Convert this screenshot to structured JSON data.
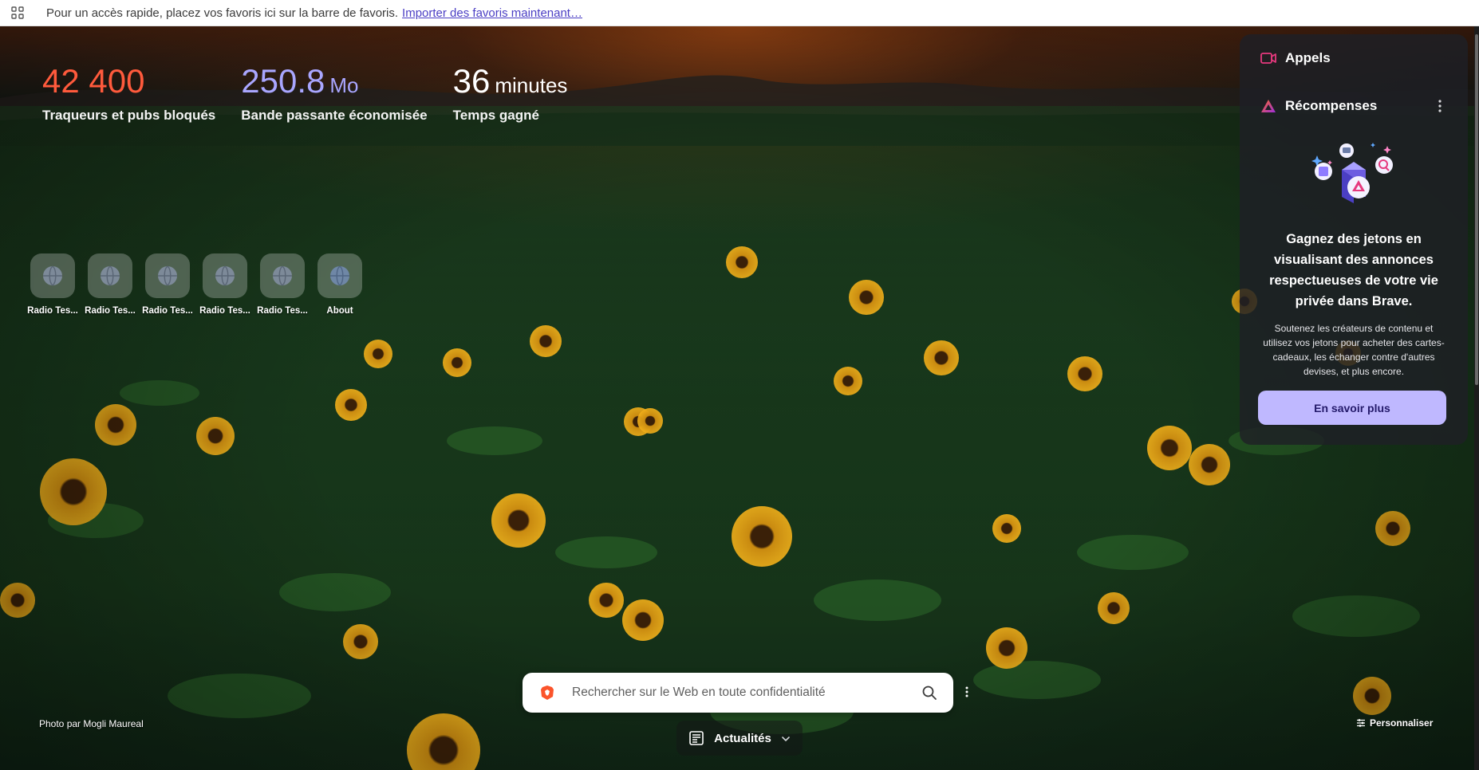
{
  "bookmarks_bar": {
    "message": "Pour un accès rapide, placez vos favoris ici sur la barre de favoris.",
    "import_link": "Importer des favoris maintenant…",
    "apps_icon": "apps-grid-icon"
  },
  "stats": {
    "trackers": {
      "value": "42 400",
      "label": "Traqueurs et pubs bloqués",
      "color": "#ff5a3c"
    },
    "bandwidth": {
      "value": "250.8",
      "unit": "Mo",
      "label": "Bande passante économisée",
      "color": "#a9a6ff"
    },
    "time": {
      "value": "36",
      "unit": "minutes",
      "label": "Temps gagné",
      "color": "#ffffff"
    }
  },
  "top_sites": [
    {
      "label": "Radio Tes...",
      "icon": "globe-icon"
    },
    {
      "label": "Radio Tes...",
      "icon": "globe-icon"
    },
    {
      "label": "Radio Tes...",
      "icon": "globe-icon"
    },
    {
      "label": "Radio Tes...",
      "icon": "globe-icon"
    },
    {
      "label": "Radio Tes...",
      "icon": "globe-icon"
    },
    {
      "label": "About",
      "icon": "globe-icon"
    }
  ],
  "widgets": {
    "calls": {
      "title": "Appels",
      "icon": "video-call-icon",
      "color": "#e6397e"
    },
    "rewards": {
      "title": "Récompenses",
      "icon": "brave-rewards-icon",
      "heading": "Gagnez des jetons en visualisant des annonces respectueuses de votre vie privée dans Brave.",
      "body": "Soutenez les créateurs de contenu et utilisez vos jetons pour acheter des cartes-cadeaux, les échanger contre d'autres devises, et plus encore.",
      "button": "En savoir plus",
      "button_color": "#bfb8ff"
    }
  },
  "search": {
    "placeholder": "Rechercher sur le Web en toute confidentialité",
    "value": ""
  },
  "news": {
    "label": "Actualités"
  },
  "footer": {
    "photo_credit": "Photo par Mogli Maureal",
    "customize": "Personnaliser"
  }
}
